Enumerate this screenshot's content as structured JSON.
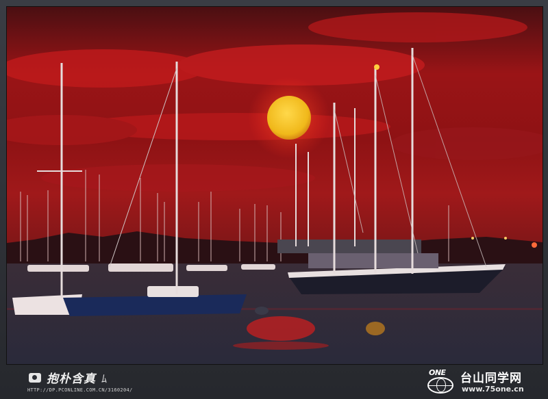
{
  "photo": {
    "scene": "harbor-sunset",
    "colors": {
      "sky_top": "#5a1212",
      "sky_mid": "#b01818",
      "sky_low": "#8a1010",
      "sun": "#f2c21c",
      "water": "#2b2a3a",
      "reflection": "#c91f1f"
    }
  },
  "footer": {
    "author_name": "抱朴含真",
    "author_mark": "ﾑ",
    "author_url": "HTTP://DP.PCONLINE.COM.CN/3160204/",
    "site_logo_text": "ONE",
    "site_name": "台山同学网",
    "site_url": "www.75one.cn"
  }
}
